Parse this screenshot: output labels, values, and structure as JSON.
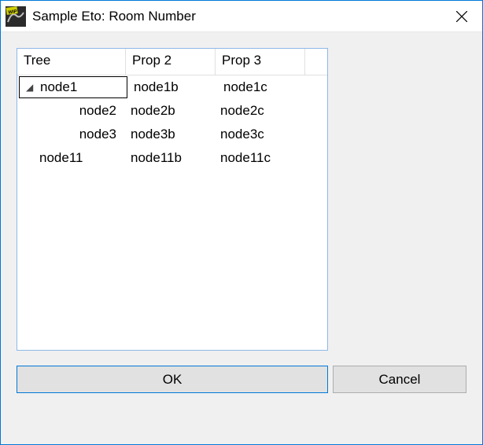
{
  "window": {
    "title": "Sample Eto: Room Number"
  },
  "grid": {
    "headers": {
      "tree": "Tree",
      "prop2": "Prop 2",
      "prop3": "Prop 3"
    },
    "rows": [
      {
        "level": 0,
        "expanded": true,
        "selected": true,
        "label": "node1",
        "p2": "node1b",
        "p3": "node1c"
      },
      {
        "level": 1,
        "label": "node2",
        "p2": "node2b",
        "p3": "node2c"
      },
      {
        "level": 1,
        "label": "node3",
        "p2": "node3b",
        "p3": "node3c"
      },
      {
        "level": 0,
        "label": "node11",
        "p2": "node11b",
        "p3": "node11c"
      }
    ]
  },
  "buttons": {
    "ok": "OK",
    "cancel": "Cancel"
  }
}
